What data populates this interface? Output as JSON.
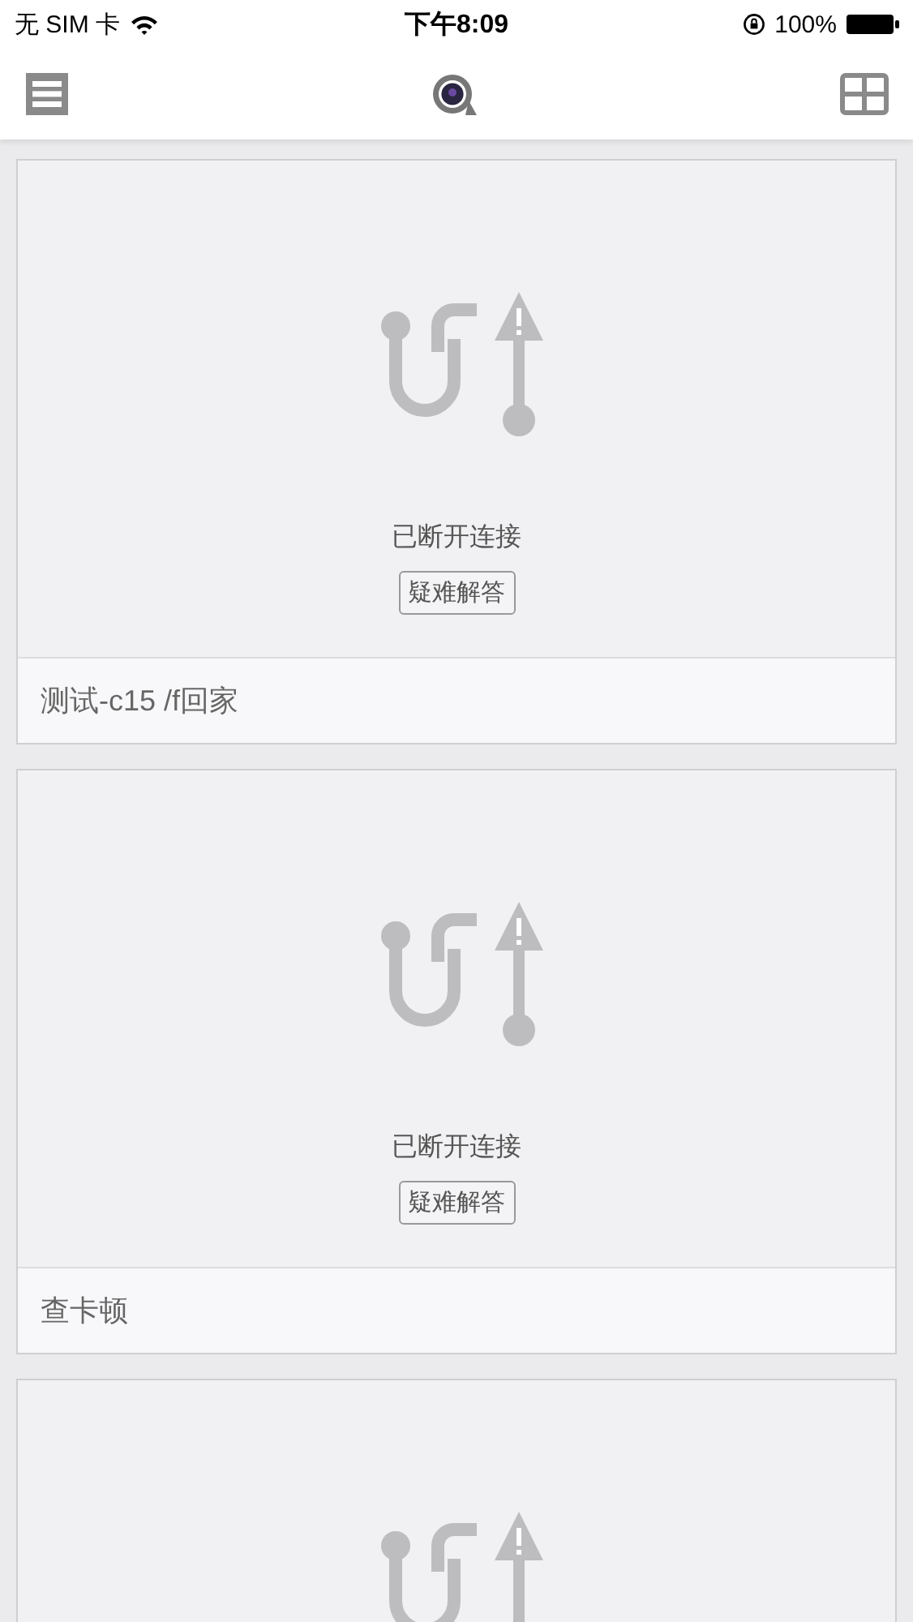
{
  "status_bar": {
    "carrier": "无 SIM 卡",
    "time": "下午8:09",
    "battery": "100%"
  },
  "cameras": [
    {
      "kind": "disconnected",
      "status": "已断开连接",
      "help_button": "疑难解答",
      "name": "测试-c15 /f回家"
    },
    {
      "kind": "disconnected",
      "status": "已断开连接",
      "help_button": "疑难解答",
      "name": "查卡顿"
    },
    {
      "kind": "disconnected"
    }
  ]
}
